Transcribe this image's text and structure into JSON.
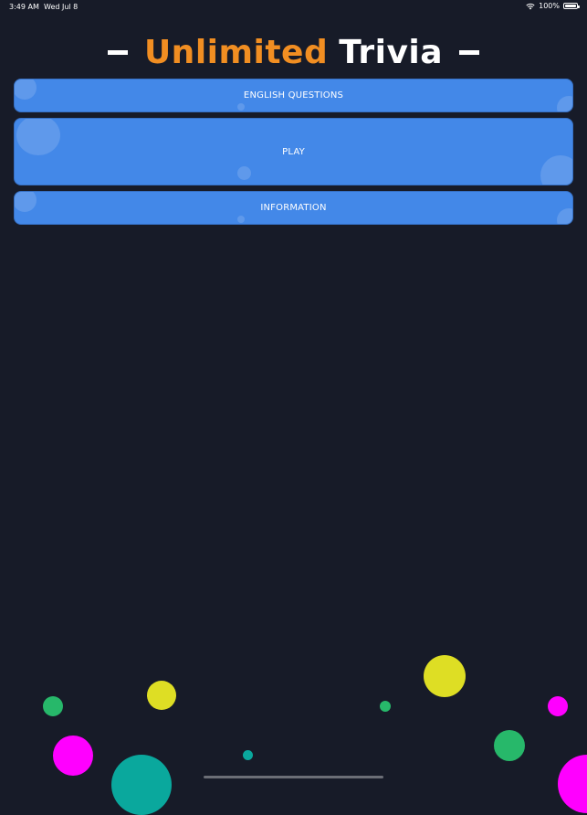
{
  "status_bar": {
    "time": "3:49 AM",
    "date": "Wed Jul 8",
    "battery": "100%"
  },
  "title": {
    "part1": "Unlimited",
    "part2": "Trivia"
  },
  "buttons": {
    "language": "ENGLISH QUESTIONS",
    "play": "PLAY",
    "information": "INFORMATION"
  },
  "colors": {
    "background": "#171b28",
    "button": "#4388e8",
    "title_accent": "#f18e22",
    "confetti_yellow": "#dede24",
    "confetti_magenta": "#ff00ff",
    "confetti_green": "#27b86a",
    "confetti_teal": "#0aa89d"
  },
  "icons": {
    "wifi": "wifi-icon",
    "battery": "battery-icon"
  }
}
